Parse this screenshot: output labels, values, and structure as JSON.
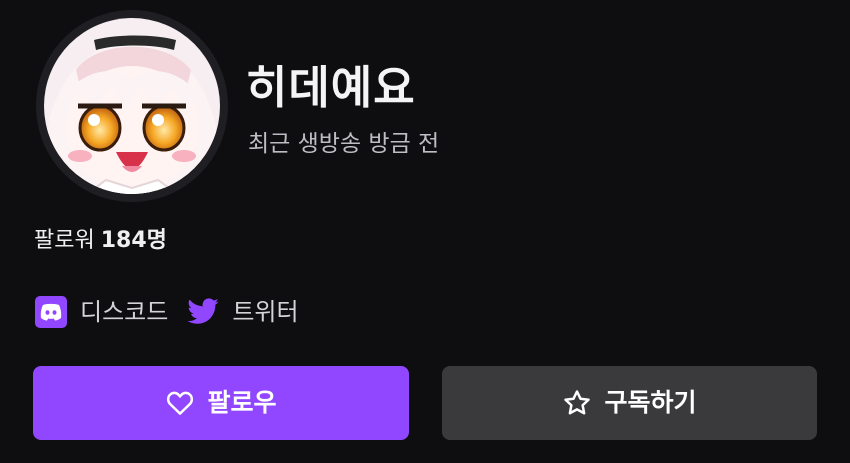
{
  "channel": {
    "name": "히데예요",
    "last_live": "최근 생방송 방금 전",
    "followers_label": "팔로워",
    "followers_count": "184명"
  },
  "socials": [
    {
      "label": "디스코드",
      "icon": "discord-icon"
    },
    {
      "label": "트위터",
      "icon": "twitter-icon"
    }
  ],
  "buttons": {
    "follow_label": "팔로우",
    "follow_icon": "heart-icon",
    "subscribe_label": "구독하기",
    "subscribe_icon": "star-icon"
  },
  "colors": {
    "background": "#0e0e10",
    "accent": "#9147ff",
    "secondary_button": "#3a3a3d"
  }
}
